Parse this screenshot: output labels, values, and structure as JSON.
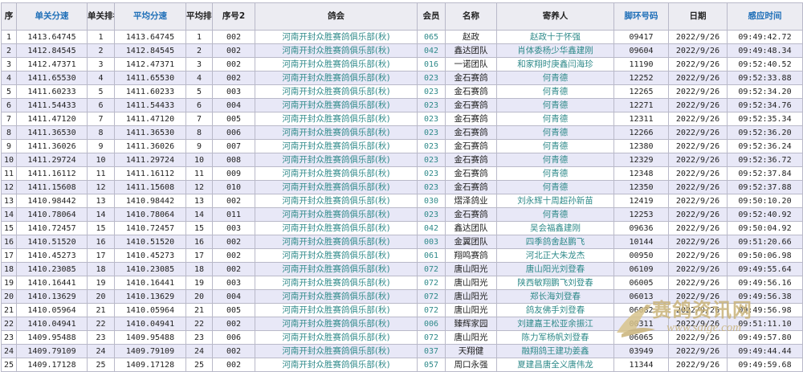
{
  "headers": {
    "seq": "序",
    "single_speed": "单关分速",
    "single_rank": "单关排名",
    "avg_speed": "平均分速",
    "avg_rank": "平均排名",
    "seq2": "序号2",
    "club": "鸽会",
    "member": "会员",
    "name": "名称",
    "owner": "寄养人",
    "ring": "脚环号码",
    "date": "日期",
    "time": "感应时间"
  },
  "rows": [
    {
      "seq": "1",
      "speed": "1413.64745",
      "rank": "1",
      "avg": "1413.64745",
      "avg_rank": "1",
      "seq2": "002",
      "club": "河南开封众胜赛鸽俱乐部(秋)",
      "member": "065",
      "name": "赵政",
      "owner": "赵政十于怀强",
      "ring": "09417",
      "date": "2022/9/26",
      "time": "09:49:42.72"
    },
    {
      "seq": "2",
      "speed": "1412.84545",
      "rank": "2",
      "avg": "1412.84545",
      "avg_rank": "2",
      "seq2": "002",
      "club": "河南开封众胜赛鸽俱乐部(秋)",
      "member": "042",
      "name": "鑫达团队",
      "owner": "肖体委杨少华鑫建刚",
      "ring": "09604",
      "date": "2022/9/26",
      "time": "09:49:48.34"
    },
    {
      "seq": "3",
      "speed": "1412.47371",
      "rank": "3",
      "avg": "1412.47371",
      "avg_rank": "3",
      "seq2": "002",
      "club": "河南开封众胜赛鸽俱乐部(秋)",
      "member": "016",
      "name": "一诺团队",
      "owner": "和家翔时庚鑫闫海珍",
      "ring": "11190",
      "date": "2022/9/26",
      "time": "09:52:40.52"
    },
    {
      "seq": "4",
      "speed": "1411.65530",
      "rank": "4",
      "avg": "1411.65530",
      "avg_rank": "4",
      "seq2": "002",
      "club": "河南开封众胜赛鸽俱乐部(秋)",
      "member": "023",
      "name": "金石赛鸽",
      "owner": "何青德",
      "ring": "12252",
      "date": "2022/9/26",
      "time": "09:52:33.88"
    },
    {
      "seq": "5",
      "speed": "1411.60233",
      "rank": "5",
      "avg": "1411.60233",
      "avg_rank": "5",
      "seq2": "003",
      "club": "河南开封众胜赛鸽俱乐部(秋)",
      "member": "023",
      "name": "金石赛鸽",
      "owner": "何青德",
      "ring": "12265",
      "date": "2022/9/26",
      "time": "09:52:34.20"
    },
    {
      "seq": "6",
      "speed": "1411.54433",
      "rank": "6",
      "avg": "1411.54433",
      "avg_rank": "6",
      "seq2": "004",
      "club": "河南开封众胜赛鸽俱乐部(秋)",
      "member": "023",
      "name": "金石赛鸽",
      "owner": "何青德",
      "ring": "12271",
      "date": "2022/9/26",
      "time": "09:52:34.76"
    },
    {
      "seq": "7",
      "speed": "1411.47120",
      "rank": "7",
      "avg": "1411.47120",
      "avg_rank": "7",
      "seq2": "005",
      "club": "河南开封众胜赛鸽俱乐部(秋)",
      "member": "023",
      "name": "金石赛鸽",
      "owner": "何青德",
      "ring": "12311",
      "date": "2022/9/26",
      "time": "09:52:35.34"
    },
    {
      "seq": "8",
      "speed": "1411.36530",
      "rank": "8",
      "avg": "1411.36530",
      "avg_rank": "8",
      "seq2": "006",
      "club": "河南开封众胜赛鸽俱乐部(秋)",
      "member": "023",
      "name": "金石赛鸽",
      "owner": "何青德",
      "ring": "12266",
      "date": "2022/9/26",
      "time": "09:52:36.20"
    },
    {
      "seq": "9",
      "speed": "1411.36026",
      "rank": "9",
      "avg": "1411.36026",
      "avg_rank": "9",
      "seq2": "007",
      "club": "河南开封众胜赛鸽俱乐部(秋)",
      "member": "023",
      "name": "金石赛鸽",
      "owner": "何青德",
      "ring": "12380",
      "date": "2022/9/26",
      "time": "09:52:36.24"
    },
    {
      "seq": "10",
      "speed": "1411.29724",
      "rank": "10",
      "avg": "1411.29724",
      "avg_rank": "10",
      "seq2": "008",
      "club": "河南开封众胜赛鸽俱乐部(秋)",
      "member": "023",
      "name": "金石赛鸽",
      "owner": "何青德",
      "ring": "12329",
      "date": "2022/9/26",
      "time": "09:52:36.72"
    },
    {
      "seq": "11",
      "speed": "1411.16112",
      "rank": "11",
      "avg": "1411.16112",
      "avg_rank": "11",
      "seq2": "009",
      "club": "河南开封众胜赛鸽俱乐部(秋)",
      "member": "023",
      "name": "金石赛鸽",
      "owner": "何青德",
      "ring": "12348",
      "date": "2022/9/26",
      "time": "09:52:37.84"
    },
    {
      "seq": "12",
      "speed": "1411.15608",
      "rank": "12",
      "avg": "1411.15608",
      "avg_rank": "12",
      "seq2": "010",
      "club": "河南开封众胜赛鸽俱乐部(秋)",
      "member": "023",
      "name": "金石赛鸽",
      "owner": "何青德",
      "ring": "12350",
      "date": "2022/9/26",
      "time": "09:52:37.88"
    },
    {
      "seq": "13",
      "speed": "1410.98442",
      "rank": "13",
      "avg": "1410.98442",
      "avg_rank": "13",
      "seq2": "002",
      "club": "河南开封众胜赛鸽俱乐部(秋)",
      "member": "030",
      "name": "熠泽鸽业",
      "owner": "刘永辉十周超孙新苗",
      "ring": "12419",
      "date": "2022/9/26",
      "time": "09:50:10.20"
    },
    {
      "seq": "14",
      "speed": "1410.78064",
      "rank": "14",
      "avg": "1410.78064",
      "avg_rank": "14",
      "seq2": "011",
      "club": "河南开封众胜赛鸽俱乐部(秋)",
      "member": "023",
      "name": "金石赛鸽",
      "owner": "何青德",
      "ring": "12253",
      "date": "2022/9/26",
      "time": "09:52:40.92"
    },
    {
      "seq": "15",
      "speed": "1410.72457",
      "rank": "15",
      "avg": "1410.72457",
      "avg_rank": "15",
      "seq2": "003",
      "club": "河南开封众胜赛鸽俱乐部(秋)",
      "member": "042",
      "name": "鑫达团队",
      "owner": "吴会福鑫建刚",
      "ring": "09636",
      "date": "2022/9/26",
      "time": "09:50:04.92"
    },
    {
      "seq": "16",
      "speed": "1410.51520",
      "rank": "16",
      "avg": "1410.51520",
      "avg_rank": "16",
      "seq2": "002",
      "club": "河南开封众胜赛鸽俱乐部(秋)",
      "member": "003",
      "name": "金翼团队",
      "owner": "四季鸽舍赵鹏飞",
      "ring": "10144",
      "date": "2022/9/26",
      "time": "09:51:20.66"
    },
    {
      "seq": "17",
      "speed": "1410.45273",
      "rank": "17",
      "avg": "1410.45273",
      "avg_rank": "17",
      "seq2": "002",
      "club": "河南开封众胜赛鸽俱乐部(秋)",
      "member": "061",
      "name": "翔鸣赛鸽",
      "owner": "河北正大朱龙杰",
      "ring": "00950",
      "date": "2022/9/26",
      "time": "09:50:06.98"
    },
    {
      "seq": "18",
      "speed": "1410.23085",
      "rank": "18",
      "avg": "1410.23085",
      "avg_rank": "18",
      "seq2": "002",
      "club": "河南开封众胜赛鸽俱乐部(秋)",
      "member": "072",
      "name": "唐山阳光",
      "owner": "唐山阳光刘登春",
      "ring": "06109",
      "date": "2022/9/26",
      "time": "09:49:55.64"
    },
    {
      "seq": "19",
      "speed": "1410.16441",
      "rank": "19",
      "avg": "1410.16441",
      "avg_rank": "19",
      "seq2": "003",
      "club": "河南开封众胜赛鸽俱乐部(秋)",
      "member": "072",
      "name": "唐山阳光",
      "owner": "陕西敏翔鹏飞刘登春",
      "ring": "06005",
      "date": "2022/9/26",
      "time": "09:49:56.16"
    },
    {
      "seq": "20",
      "speed": "1410.13629",
      "rank": "20",
      "avg": "1410.13629",
      "avg_rank": "20",
      "seq2": "004",
      "club": "河南开封众胜赛鸽俱乐部(秋)",
      "member": "072",
      "name": "唐山阳光",
      "owner": "郑长海刘登春",
      "ring": "06013",
      "date": "2022/9/26",
      "time": "09:49:56.38"
    },
    {
      "seq": "21",
      "speed": "1410.05964",
      "rank": "21",
      "avg": "1410.05964",
      "avg_rank": "21",
      "seq2": "005",
      "club": "河南开封众胜赛鸽俱乐部(秋)",
      "member": "072",
      "name": "唐山阳光",
      "owner": "鸽友佛手刘登春",
      "ring": "06082",
      "date": "2022/9/26",
      "time": "09:49:56.98"
    },
    {
      "seq": "22",
      "speed": "1410.04941",
      "rank": "22",
      "avg": "1410.04941",
      "avg_rank": "22",
      "seq2": "002",
      "club": "河南开封众胜赛鸽俱乐部(秋)",
      "member": "006",
      "name": "臻辉家园",
      "owner": "刘建嘉王松亚余振江",
      "ring": "00311",
      "date": "2022/9/26",
      "time": "09:51:11.10"
    },
    {
      "seq": "23",
      "speed": "1409.95488",
      "rank": "23",
      "avg": "1409.95488",
      "avg_rank": "23",
      "seq2": "006",
      "club": "河南开封众胜赛鸽俱乐部(秋)",
      "member": "072",
      "name": "唐山阳光",
      "owner": "陈力军杨帆刘登春",
      "ring": "06065",
      "date": "2022/9/26",
      "time": "09:49:57.80"
    },
    {
      "seq": "24",
      "speed": "1409.79109",
      "rank": "24",
      "avg": "1409.79109",
      "avg_rank": "24",
      "seq2": "002",
      "club": "河南开封众胜赛鸽俱乐部(秋)",
      "member": "037",
      "name": "天翔健",
      "owner": "融翔鸽王建功姜鑫",
      "ring": "03949",
      "date": "2022/9/26",
      "time": "09:49:44.44"
    },
    {
      "seq": "25",
      "speed": "1409.17128",
      "rank": "25",
      "avg": "1409.17128",
      "avg_rank": "25",
      "seq2": "002",
      "club": "河南开封众胜赛鸽俱乐部(秋)",
      "member": "057",
      "name": "周口永强",
      "owner": "夏建昌唐全义唐伟龙",
      "ring": "11344",
      "date": "2022/9/26",
      "time": "09:49:59.68"
    }
  ],
  "watermark": {
    "title": "赛鸽资讯网",
    "url": "www.saige.com"
  }
}
